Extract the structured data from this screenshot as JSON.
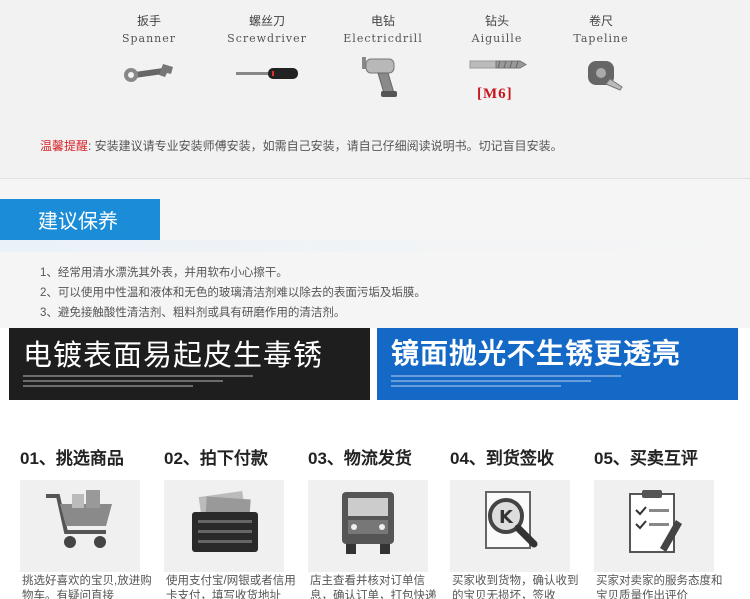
{
  "tools": {
    "items": [
      {
        "cn": "扳手",
        "en": "Spanner",
        "icon": "spanner-icon"
      },
      {
        "cn": "螺丝刀",
        "en": "Screwdriver",
        "icon": "screwdriver-icon"
      },
      {
        "cn": "电钻",
        "en": "Electricdrill",
        "icon": "electric-drill-icon"
      },
      {
        "cn": "钻头",
        "en": "Aiguille",
        "icon": "drill-bit-icon"
      },
      {
        "cn": "卷尺",
        "en": "Tapeline",
        "icon": "tape-measure-icon"
      }
    ],
    "bit_label": "[M6]",
    "notice_lead": "温馨提醒",
    "notice_text": ": 安装建议请专业安装师傅安装，如需自己安装，请自己仔细阅读说明书。切记盲目安装。"
  },
  "maintenance": {
    "title": "建议保养",
    "tips": [
      "1、经常用清水漂洗其外表，并用软布小心擦干。",
      "2、可以使用中性温和液体和无色的玻璃清洁剂难以除去的表面污垢及垢膜。",
      "3、避免接触酸性清洁剂、粗料剂或具有研磨作用的清洁剂。"
    ]
  },
  "banners": {
    "left": "电镀表面易起皮生毒锈",
    "right": "镜面抛光不生锈更透亮"
  },
  "steps": [
    {
      "label": "01、挑选商品",
      "icon": "shopping-cart-icon",
      "desc": "挑选好喜欢的宝贝,放进购物车。有疑问直接"
    },
    {
      "label": "02、拍下付款",
      "icon": "wallet-icon",
      "desc": "使用支付宝/网银或者信用卡支付，填写收货地址"
    },
    {
      "label": "03、物流发货",
      "icon": "delivery-truck-icon",
      "desc": "店主查看并核对订单信息，确认订单，打包快递"
    },
    {
      "label": "04、到货签收",
      "icon": "package-inspect-icon",
      "desc": "买家收到货物，确认收到的宝贝无损坏，签收"
    },
    {
      "label": "05、买卖互评",
      "icon": "review-clipboard-icon",
      "desc": "买家对卖家的服务态度和宝贝质量作出评价"
    }
  ],
  "colors": {
    "accent_blue": "#1a8cd8",
    "notice_red": "#d6252b",
    "bit_red": "#c8141b",
    "banner_dark": "#1e1e1e",
    "banner_blue": "#1569c6"
  }
}
